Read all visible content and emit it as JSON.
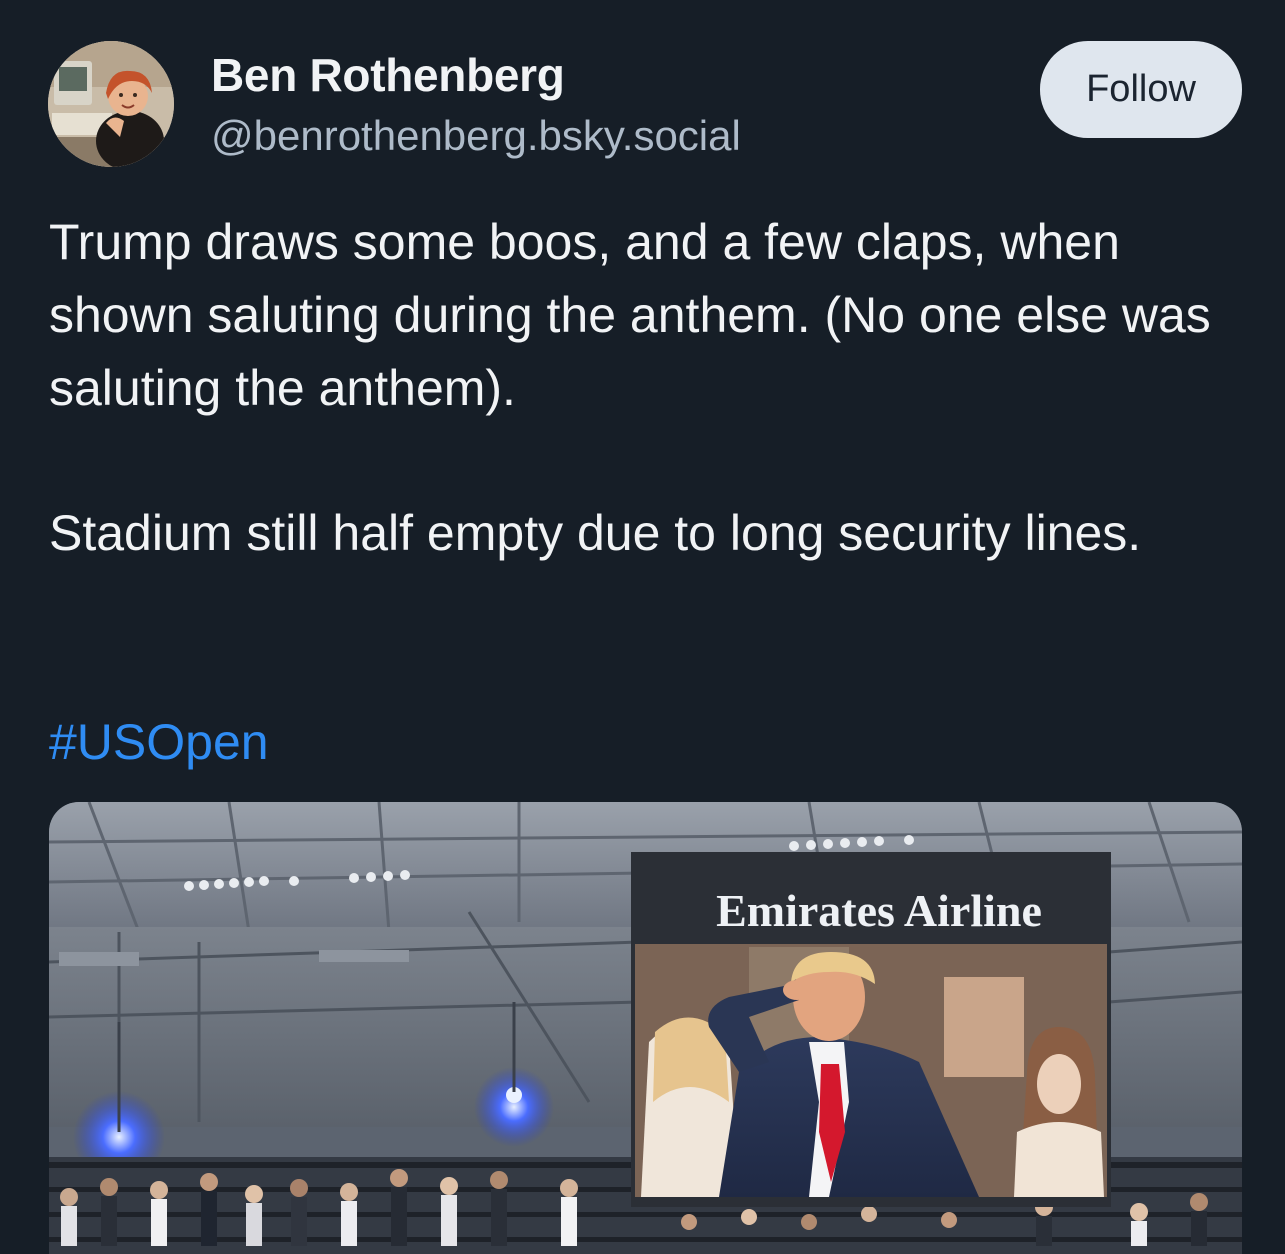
{
  "author": {
    "display_name": "Ben Rothenberg",
    "handle": "@benrothenberg.bsky.social"
  },
  "actions": {
    "follow_label": "Follow"
  },
  "post": {
    "paragraph_1": "Trump draws some boos, and a few claps, when shown saluting during the anthem. (No one else was saluting the anthem).",
    "paragraph_2": "Stadium still half empty due to long security lines.",
    "hashtag": "#USOpen"
  },
  "media": {
    "jumbotron_text": "Emirates Airline"
  },
  "colors": {
    "background": "#161e27",
    "text": "#f1f3f5",
    "handle": "#aebbc9",
    "hashtag": "#2f8cf3",
    "follow_button_bg": "#dfe6ee"
  }
}
